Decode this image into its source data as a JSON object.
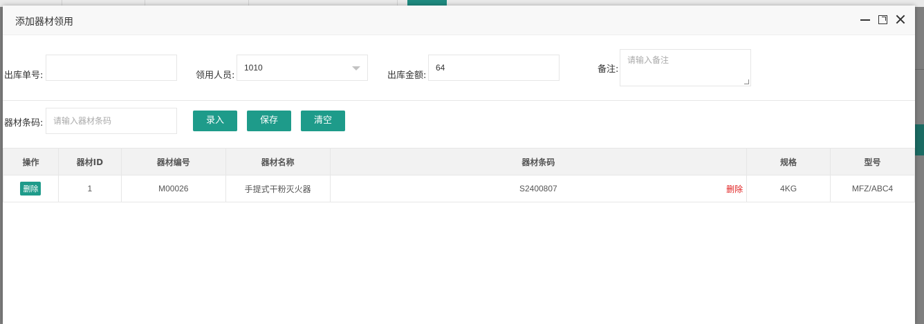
{
  "modal": {
    "title": "添加器材领用"
  },
  "form": {
    "out_no_label": "出库单号:",
    "out_no_value": "",
    "receiver_label": "领用人员:",
    "receiver_value": "1010",
    "amount_label": "出库金额:",
    "amount_value": "64",
    "remark_label": "备注:",
    "remark_placeholder": "请输入备注",
    "barcode_label": "器材条码:",
    "barcode_placeholder": "请输入器材条码"
  },
  "buttons": {
    "enter": "录入",
    "save": "保存",
    "clear": "清空"
  },
  "table": {
    "headers": [
      "操作",
      "器材ID",
      "器材编号",
      "器材名称",
      "器材条码",
      "规格",
      "型号"
    ],
    "rows": [
      {
        "action": "删除",
        "id": "1",
        "code": "M00026",
        "name": "手提式干粉灭火器",
        "barcode": "S2400807",
        "barcode_action": "删除",
        "spec": "4KG",
        "model": "MFZ/ABC4"
      }
    ]
  },
  "colors": {
    "accent": "#1e9b8a",
    "danger": "#e02020"
  }
}
